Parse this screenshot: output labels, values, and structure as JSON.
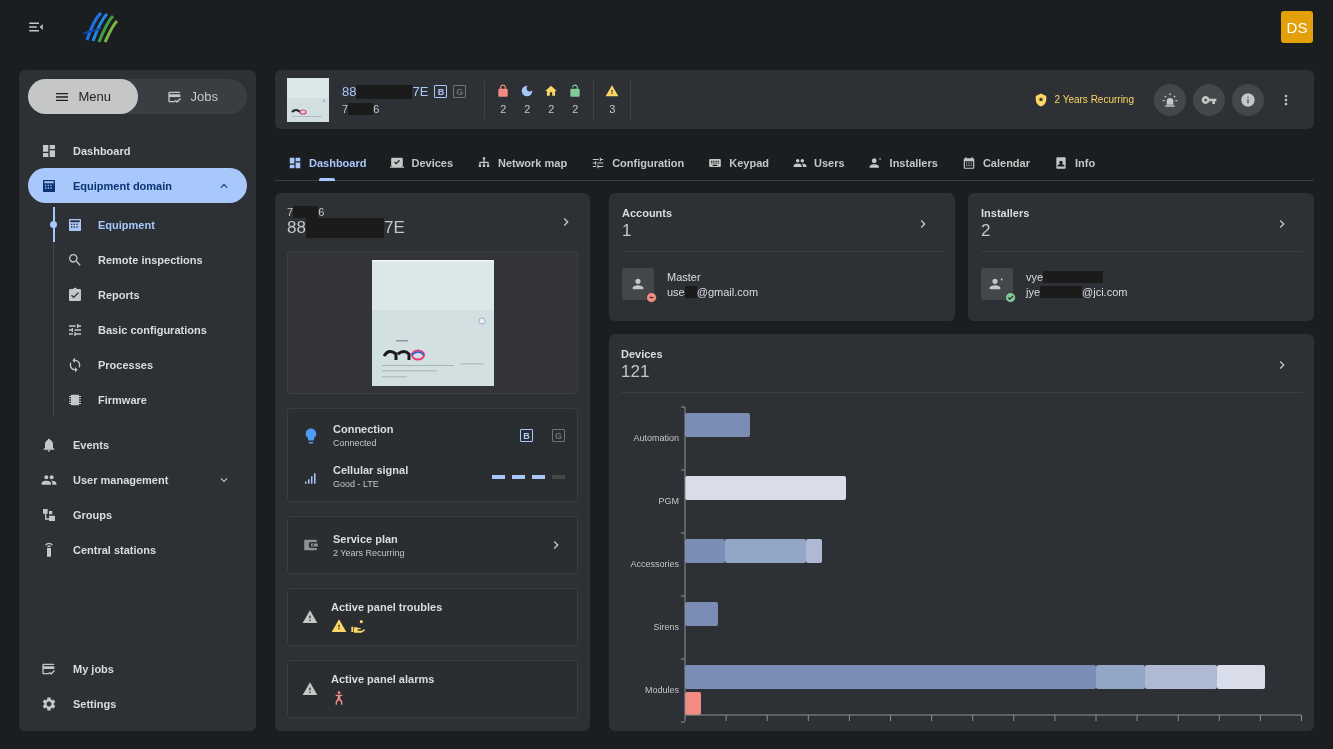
{
  "topbar": {
    "avatar": "DS"
  },
  "sidebar": {
    "switch": [
      {
        "label": "Menu",
        "selected": true
      },
      {
        "label": "Jobs",
        "selected": false
      }
    ],
    "items": [
      {
        "label": "Dashboard",
        "selected": false
      },
      {
        "label": "Equipment domain",
        "selected": true,
        "expanded": true,
        "children": [
          {
            "label": "Equipment",
            "selected": true
          },
          {
            "label": "Remote inspections",
            "selected": false
          },
          {
            "label": "Reports",
            "selected": false
          },
          {
            "label": "Basic configurations",
            "selected": false
          },
          {
            "label": "Processes",
            "selected": false
          },
          {
            "label": "Firmware",
            "selected": false
          }
        ]
      },
      {
        "label": "Events",
        "selected": false
      },
      {
        "label": "User management",
        "selected": false,
        "expanded": false
      },
      {
        "label": "Groups",
        "selected": false
      },
      {
        "label": "Central stations",
        "selected": false
      }
    ],
    "bottom_items": [
      {
        "label": "My jobs",
        "selected": false
      },
      {
        "label": "Settings",
        "selected": false
      }
    ]
  },
  "header": {
    "id_prefix": "88",
    "id_suffix": "7E",
    "code_prefix": "7",
    "code_suffix": "6",
    "badges": [
      {
        "label": "B",
        "active": true
      },
      {
        "label": "G",
        "active": false
      }
    ],
    "partitions": [
      {
        "count": "2",
        "color": "#f28b82"
      },
      {
        "count": "2",
        "color": "#a8c7fa"
      },
      {
        "count": "2",
        "color": "#fdd663"
      },
      {
        "count": "2",
        "color": "#81c995"
      }
    ],
    "troubles": {
      "count": "3"
    },
    "plan": "2 Years Recurring"
  },
  "tabs": [
    {
      "label": "Dashboard",
      "selected": true
    },
    {
      "label": "Devices",
      "selected": false
    },
    {
      "label": "Network map",
      "selected": false
    },
    {
      "label": "Configuration",
      "selected": false
    },
    {
      "label": "Keypad",
      "selected": false
    },
    {
      "label": "Users",
      "selected": false
    },
    {
      "label": "Installers",
      "selected": false
    },
    {
      "label": "Calendar",
      "selected": false
    },
    {
      "label": "Info",
      "selected": false
    }
  ],
  "panel": {
    "code_prefix": "7",
    "code_suffix": "6",
    "id_prefix": "88",
    "id_suffix": "7E",
    "connection": {
      "title": "Connection",
      "status": "Connected",
      "badges": [
        {
          "label": "B",
          "active": true
        },
        {
          "label": "G",
          "active": false
        }
      ]
    },
    "signal": {
      "title": "Cellular signal",
      "status": "Good - LTE",
      "level": 0.75
    },
    "service": {
      "title": "Service plan",
      "value": "2 Years Recurring"
    },
    "troubles": {
      "title": "Active panel troubles"
    },
    "alarms": {
      "title": "Active panel alarms"
    }
  },
  "accounts": {
    "title": "Accounts",
    "count": "1",
    "user": {
      "role": "Master",
      "email_prefix": "use",
      "email_suffix": "@gmail.com",
      "online": false
    }
  },
  "installers": {
    "title": "Installers",
    "count": "2",
    "user": {
      "name_prefix": "vye",
      "email_prefix": "jye",
      "email_suffix": "@jci.com",
      "online": true
    }
  },
  "devices": {
    "title": "Devices",
    "count": "121",
    "categories": [
      "Automation",
      "PGM",
      "Accessories",
      "Sirens",
      "Modules"
    ]
  }
}
